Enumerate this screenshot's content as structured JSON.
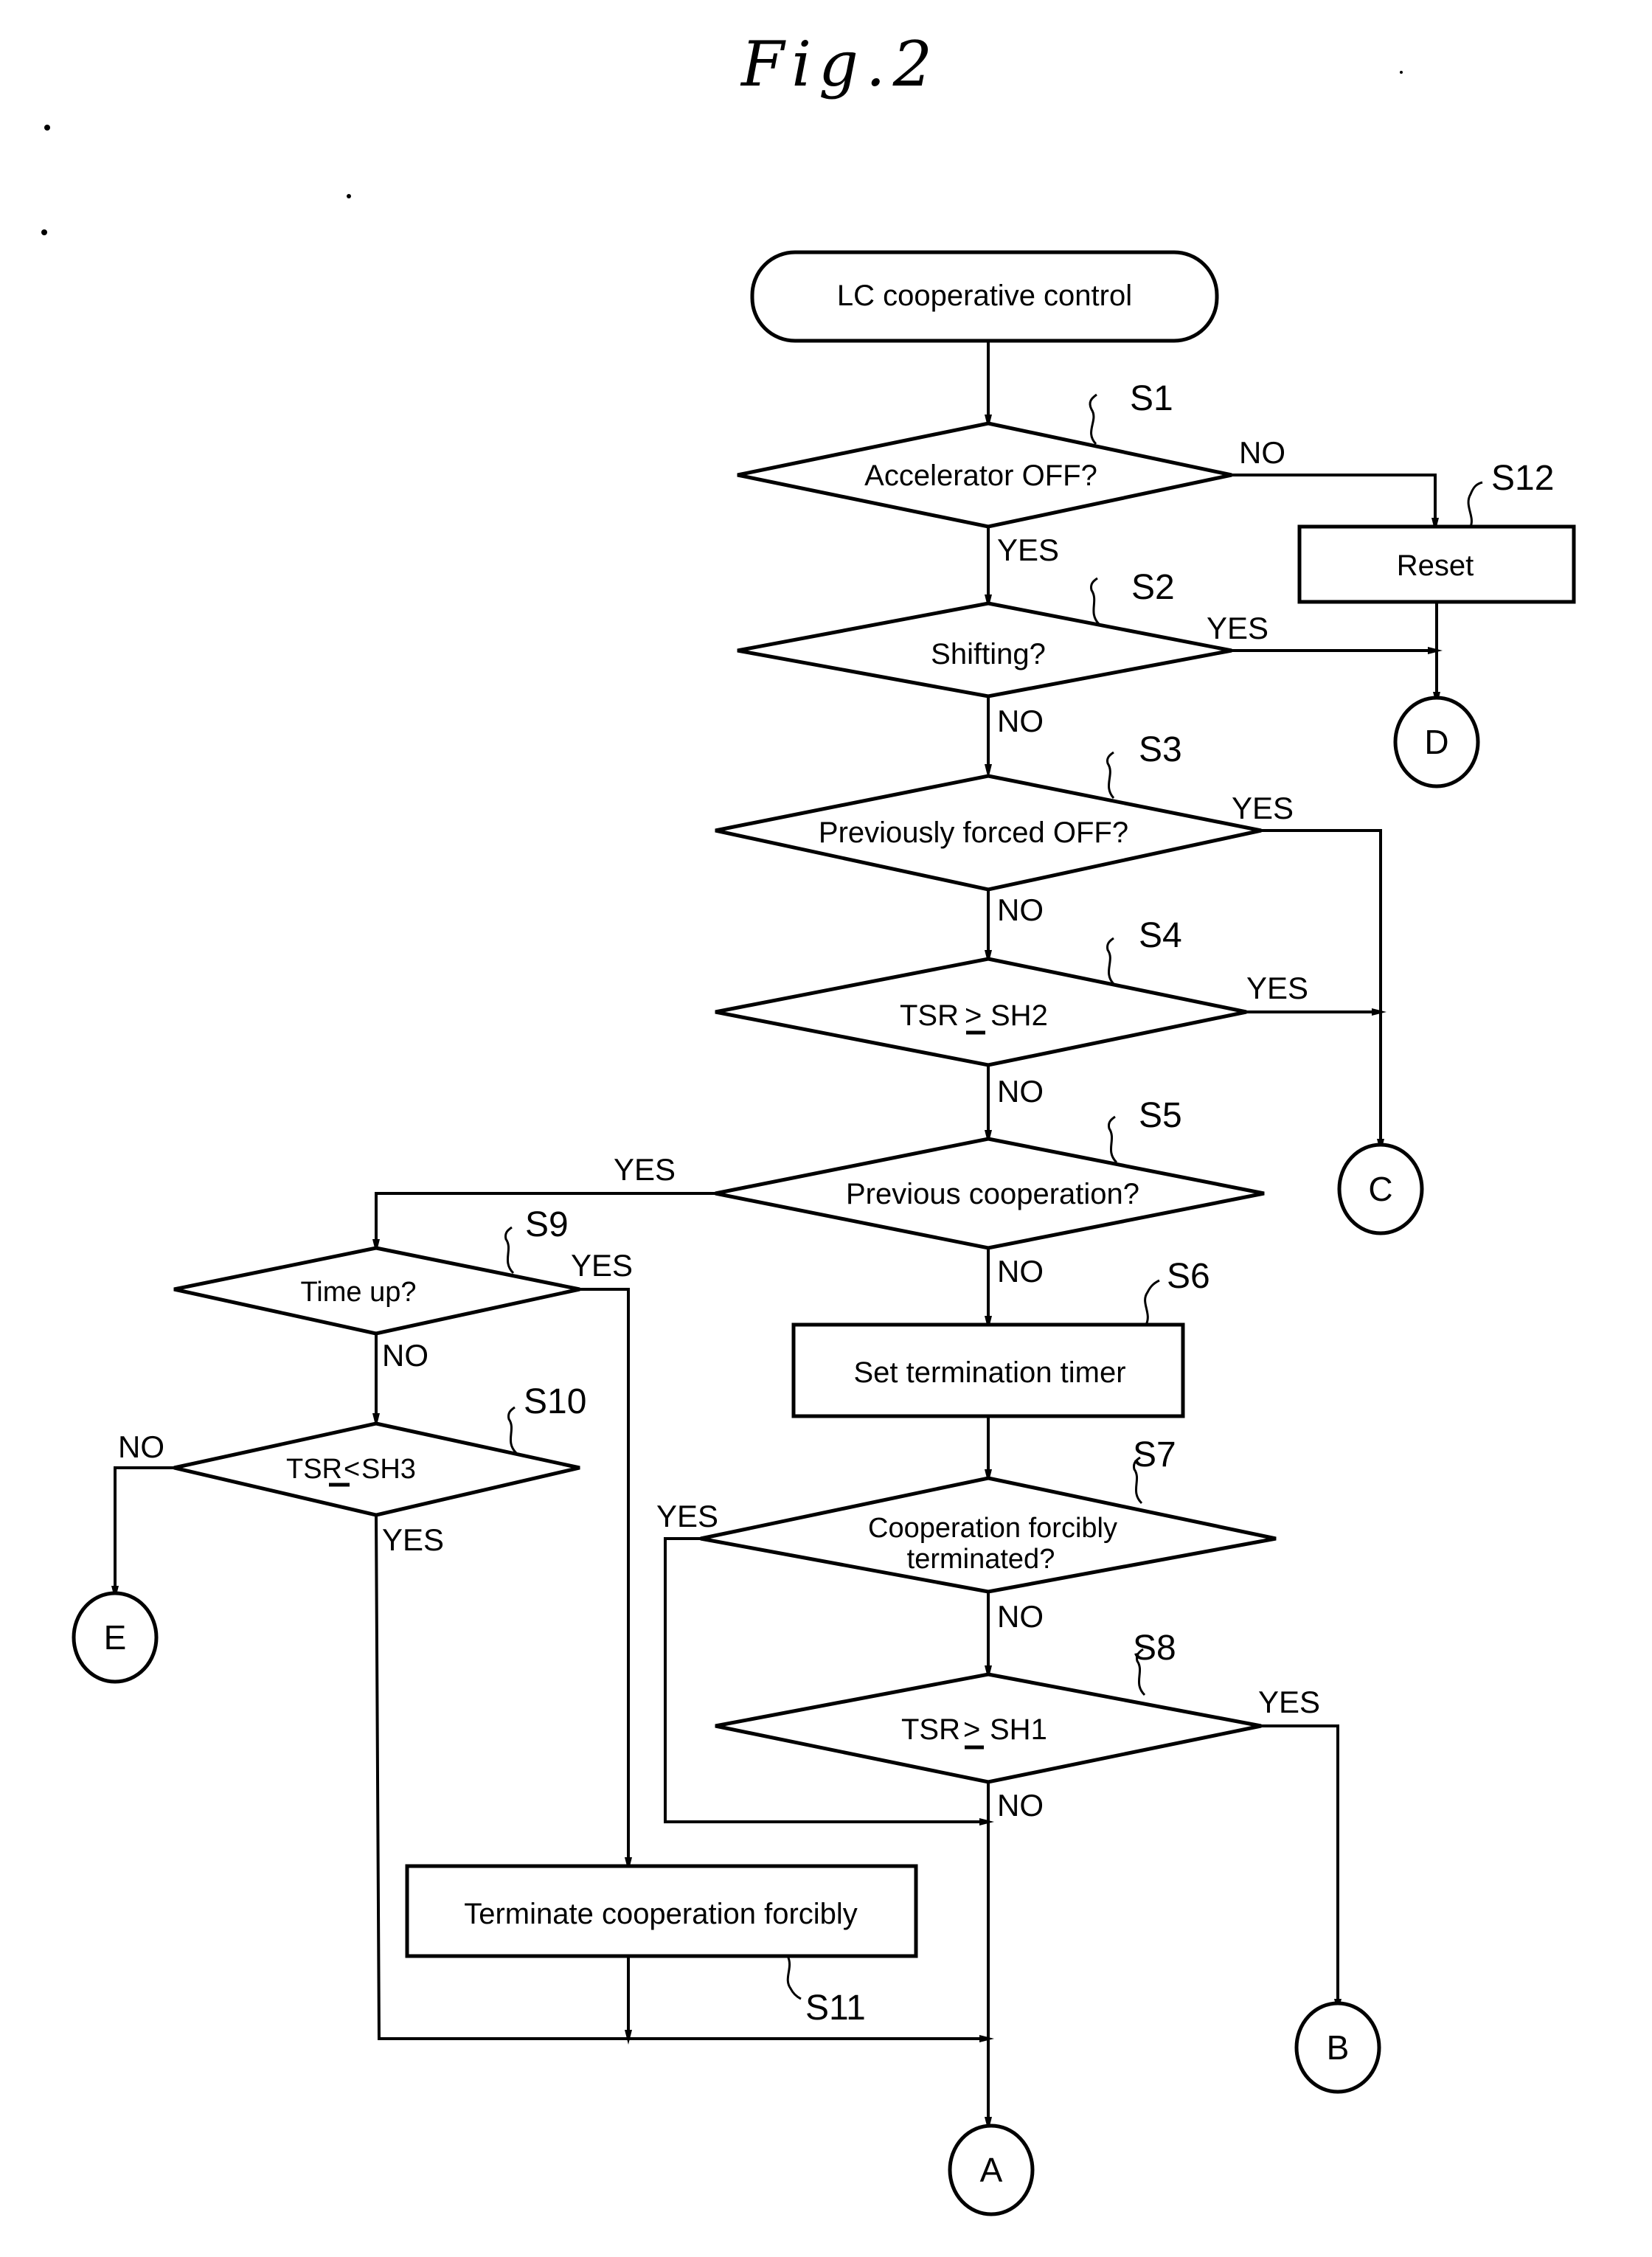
{
  "figure": {
    "title": "Fig.2"
  },
  "start": {
    "label": "LC cooperative control"
  },
  "steps": {
    "s1": {
      "id": "S1",
      "label": "Accelerator OFF?"
    },
    "s2": {
      "id": "S2",
      "label": "Shifting?"
    },
    "s3": {
      "id": "S3",
      "label": "Previously forced OFF?"
    },
    "s4": {
      "id": "S4",
      "label_left": "TSR",
      "operator": "≥",
      "label_right": "SH2"
    },
    "s5": {
      "id": "S5",
      "label": "Previous cooperation?"
    },
    "s6": {
      "id": "S6",
      "label": "Set termination timer"
    },
    "s7": {
      "id": "S7",
      "label_line1": "Cooperation forcibly",
      "label_line2": "terminated?"
    },
    "s8": {
      "id": "S8",
      "label_left": "TSR",
      "operator": "≥",
      "label_right": "SH1"
    },
    "s9": {
      "id": "S9",
      "label": "Time up?"
    },
    "s10": {
      "id": "S10",
      "label_left": "TSR",
      "operator": "≤",
      "label_right": "SH3"
    },
    "s11": {
      "id": "S11",
      "label": "Terminate cooperation forcibly"
    },
    "s12": {
      "id": "S12",
      "label": "Reset"
    }
  },
  "branches": {
    "yes": "YES",
    "no": "NO"
  },
  "connectors": {
    "a": "A",
    "b": "B",
    "c": "C",
    "d": "D",
    "e": "E"
  }
}
